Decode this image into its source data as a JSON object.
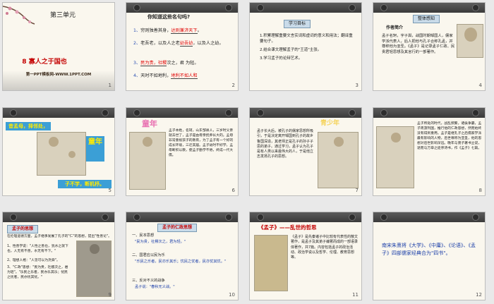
{
  "slides": [
    {
      "number": "1",
      "unit": "第三单元",
      "title": "8 寡人之于国也",
      "footer": "第一PPT模板网-WWW.1PPT.COM"
    },
    {
      "number": "2",
      "heading": "你知道这些名句吗?",
      "lines": [
        {
          "n": "1、",
          "pre": "穷则独善其身，",
          "ans": "达则兼济天下",
          "post": "。"
        },
        {
          "n": "2、",
          "pre": "老吾老，以及人之老",
          "ans": "幼吾幼",
          "post": "，以及人之幼。"
        },
        {
          "n": "3、",
          "pre": "民",
          "ans": "为贵，社稷",
          "post": "次之，君 为轻。"
        },
        {
          "n": "4、",
          "pre": "天时不如地利，",
          "ans": "地利不如人和",
          "post": ""
        }
      ]
    },
    {
      "number": "3",
      "tag": "学习目标",
      "items": [
        "1.积累理解重要文言实词和虚词的意义和用法；翻译重要句子。",
        "2.结合课文理解孟子的\"王道\"主张。",
        "3.学习孟子的论辩艺术。"
      ]
    },
    {
      "number": "4",
      "tag1": "整体感知",
      "tag2": "作者简介",
      "text": "孟子名轲，字子舆，战国时期邹国人，儒家学派代表人，后人把他与孔子合称孔孟，并尊称他为亚圣。《孟子》是记录孟子仁政、民贵君轻思想及其言行的一部著作。"
    },
    {
      "number": "5",
      "banner_top": "昔孟母，择邻处，",
      "banner_mid": "童年",
      "banner_bottom": "子不学，断机杼。"
    },
    {
      "number": "6",
      "heading": "童年",
      "text": "孟子本姓，名轲，山东邹县人，三岁时父亲就去世了，孟子是由母亲抚养长大的。孟母非常重视孩子的教育，为了孟子有一个好的成长环境，三迁其居。孟子幼时不好学，孟母断织以教，使孟子勤学不倦，终成一代大儒。"
    },
    {
      "number": "7",
      "heading": "青少年",
      "text": "孟子长大后，被孔子的儒家思想所吸引，于是决定离开邹国到孔子的故乡鲁国深造，其老师正是孔子的孙子子思的弟子。通过学习，孟子认为孔子是有人类以来最伟大的人，于是他立志发扬孔子的思想。"
    },
    {
      "number": "8",
      "text": "孟子所处的时代，战乱频繁，诸侯争霸，孟子周游列国，推行他的仁政思想，然而始终没有得到重用。孟子是继孔子之后儒家学派最有影响的人物，后世尊称为亚圣，他的思想对后世影响深远。晚年与弟子著书立说，退而与万章之徒序诗书，作《孟子》七篇。"
    },
    {
      "number": "9",
      "tag": "孟子的思想",
      "text1": "在伦理道德方面，孟子继承发展了孔子的\"仁\"的思想，提出\"性善论\"。",
      "text2": "1、性善学说：\"人性之善也，犹水之就下也，人无有不善，水无有不下。\"",
      "text3": "2、理想人格：\"人皆可以为尧舜\"。",
      "text4": "3、\"仁政\"思想：\"民为贵，社稷次之，君为轻\"。\"乐民之乐者，民亦乐其乐；忧民之忧者，民亦忧其忧。\""
    },
    {
      "number": "10",
      "tag": "孟子的仁政思想",
      "items": [
        "一、民本思想",
        "\"民为贵，社稷次之，君为轻。\"",
        "二、国君应以民为乐",
        "\"乐民之乐者，民亦乐其乐；忧民之忧者，民亦忧其忧。\"",
        "三、反对不义的战争",
        "孟子说：\"春秋无义战。\""
      ]
    },
    {
      "number": "11",
      "heading": "《孟子》——乱世的哲思",
      "text": "《孟子》是先秦诸子中比较有代表性的散文著作，是孟子及其弟子编著而成的一部语录体著作，共7篇。内容包括孟子的政治活动、政治学说以及哲学、伦理、教育思想等。"
    },
    {
      "number": "12",
      "text": "南宋朱熹将《大学》、《中庸》、《论语》、《孟子》四部儒家经典合为\"四书\"。"
    }
  ]
}
